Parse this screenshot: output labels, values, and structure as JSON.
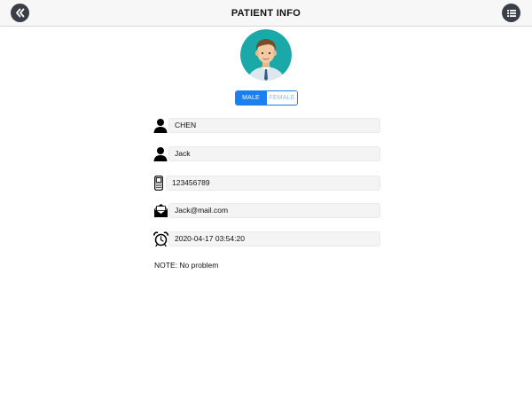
{
  "header": {
    "title": "PATIENT INFO",
    "back_icon": "double-chevron-left-icon",
    "menu_icon": "list-icon"
  },
  "gender": {
    "options": [
      "MALE",
      "FEMALE"
    ],
    "selected": "MALE"
  },
  "fields": {
    "last_name": "CHEN",
    "first_name": "Jack",
    "phone": "123456789",
    "email": "Jack@mail.com",
    "datetime": "2020-04-17 03:54:20"
  },
  "note": "NOTE: No problem",
  "colors": {
    "accent": "#1b7ff0",
    "nav_button": "#3a3f47",
    "avatar_bg": "#1aa8a8"
  }
}
